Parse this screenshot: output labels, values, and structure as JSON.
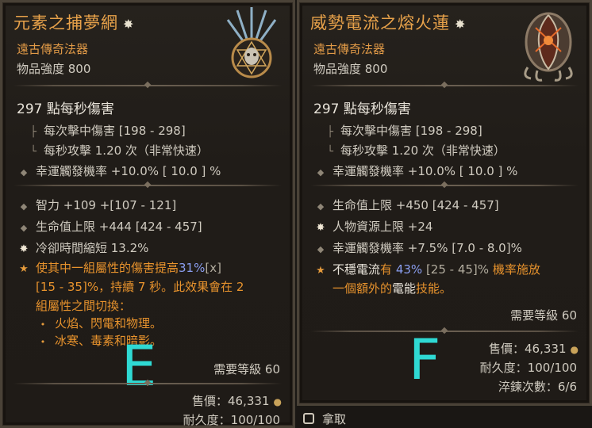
{
  "left": {
    "title": "元素之捕夢網",
    "rarity": "遠古傳奇法器",
    "item_power": "物品強度 800",
    "dps": "297 點每秒傷害",
    "damage_per_hit": "每次擊中傷害 [198 - 298]",
    "attacks_per_sec": "每秒攻擊 1.20 次（非常快速）",
    "lucky_hit": "幸運觸發機率 +10.0%  [ 10.0 ] %",
    "stats": [
      "智力 +109 +[107 - 121]",
      "生命值上限 +444 [424 - 457]",
      "冷卻時間縮短 13.2%"
    ],
    "aspect_line1_prefix": "使其中一組屬性的傷害提高",
    "aspect_line1_value": "31%",
    "aspect_line1_suffix": "[x]",
    "aspect_line2": "[15 - 35]%，持續 7 秒。此效果會在 2",
    "aspect_line3": "組屬性之間切換：",
    "aspect_sub1": "火焰、閃電和物理。",
    "aspect_sub2": "冰寒、毒素和暗影。",
    "marker": "E",
    "required_level": "需要等級 60",
    "sell_price": "售價：46,331",
    "durability": "耐久度：100/100"
  },
  "right": {
    "title": "威勢電流之熔火蓮",
    "rarity": "遠古傳奇法器",
    "item_power": "物品強度 800",
    "dps": "297 點每秒傷害",
    "damage_per_hit": "每次擊中傷害 [198 - 298]",
    "attacks_per_sec": "每秒攻擊 1.20 次（非常快速）",
    "lucky_hit": "幸運觸發機率 +10.0%  [ 10.0 ] %",
    "stats": [
      "生命值上限 +450 [424 - 457]",
      "人物資源上限 +24",
      "幸運觸發機率 +7.5% [7.0 - 8.0]%"
    ],
    "aspect_line1_prefix": "不穩電流",
    "aspect_line1_mid": "有",
    "aspect_line1_value": "43%",
    "aspect_line1_range": "[25 - 45]%",
    "aspect_line1_suffix": "機率施放",
    "aspect_line2_prefix": "一個額外的",
    "aspect_line2_mid": "電能",
    "aspect_line2_suffix": "技能。",
    "marker": "F",
    "required_level": "需要等級 60",
    "sell_price": "售價：46,331",
    "durability": "耐久度：100/100",
    "masterwork": "淬鍊次數：6/6"
  },
  "footer": {
    "pickup_label": "拿取"
  },
  "colors": {
    "legendary_orange": "#e8932d",
    "affix_blue": "#8a9ef0",
    "marker_cyan": "#2fd9d3"
  }
}
